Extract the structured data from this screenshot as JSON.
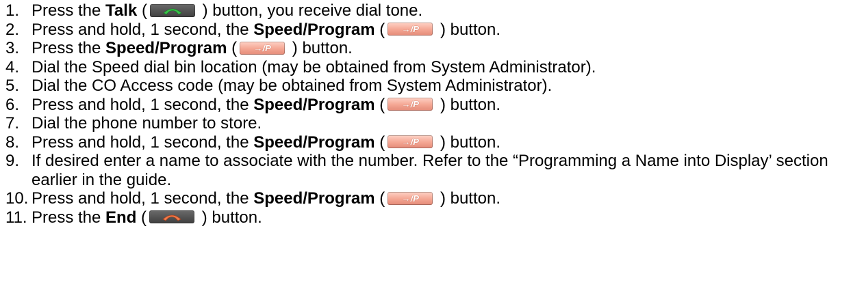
{
  "header_fragment": "",
  "button_icons": {
    "talk": "talk-handset-icon",
    "speed": "speed-program-icon",
    "end": "end-handset-icon",
    "speed_label": "→/P"
  },
  "steps": [
    {
      "num": "1.",
      "pre": "Press the ",
      "bold": "Talk",
      "open": " (",
      "btn": "talk",
      "close": " ) button, you receive dial tone."
    },
    {
      "num": "2.",
      "pre": "Press and hold, 1 second, the ",
      "bold": "Speed/Program",
      "open": " (",
      "btn": "speed",
      "close": " ) button."
    },
    {
      "num": "3.",
      "pre": "Press the ",
      "bold": "Speed/Program",
      "open": " (",
      "btn": "speed",
      "close": " ) button."
    },
    {
      "num": "4.",
      "text": "Dial the Speed dial bin location (may be obtained from System Administrator)."
    },
    {
      "num": "5.",
      "text": "Dial the CO Access code (may be obtained from System Administrator)."
    },
    {
      "num": "6.",
      "pre": "Press and hold, 1 second, the ",
      "bold": "Speed/Program",
      "open": " (",
      "btn": "speed",
      "close": " ) button."
    },
    {
      "num": "7.",
      "text": "Dial the phone number to store."
    },
    {
      "num": "8.",
      "pre": "Press and hold, 1 second, the ",
      "bold": "Speed/Program",
      "open": " (",
      "btn": "speed",
      "close": " ) button."
    },
    {
      "num": "9.",
      "text": "If desired enter a name to associate with the number.  Refer to the “Programming a Name into Display’ section earlier in the guide."
    },
    {
      "num": "10.",
      "pre": "Press and hold, 1 second, the ",
      "bold": "Speed/Program",
      "open": " (",
      "btn": "speed",
      "close": " ) button."
    },
    {
      "num": "11.",
      "pre": "Press the ",
      "bold": "End",
      "open": " (",
      "btn": "end",
      "close": " ) button."
    }
  ]
}
